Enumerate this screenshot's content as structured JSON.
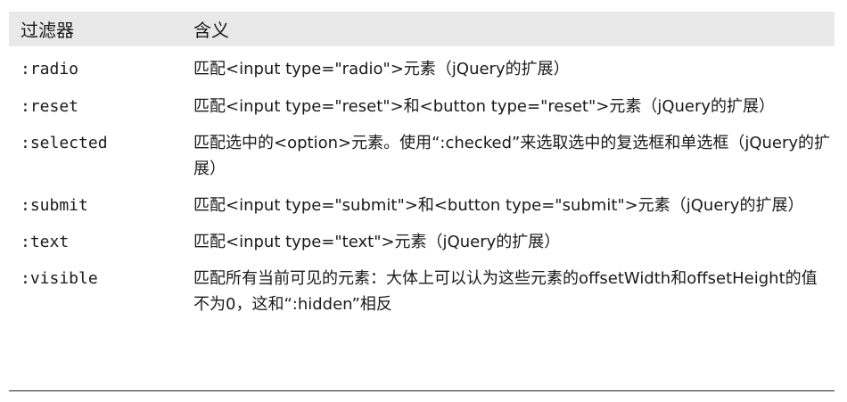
{
  "header": {
    "filter": "过滤器",
    "meaning": "含义"
  },
  "rows": [
    {
      "filter": ":radio",
      "meaning": "匹配<input type=\"radio\">元素（jQuery的扩展）"
    },
    {
      "filter": ":reset",
      "meaning": "匹配<input type=\"reset\">和<button type=\"reset\">元素（jQuery的扩展）"
    },
    {
      "filter": ":selected",
      "meaning": "匹配选中的<option>元素。使用“:checked”来选取选中的复选框和单选框（jQuery的扩展）"
    },
    {
      "filter": ":submit",
      "meaning": "匹配<input type=\"submit\">和<button type=\"submit\">元素（jQuery的扩展）"
    },
    {
      "filter": ":text",
      "meaning": "匹配<input type=\"text\">元素（jQuery的扩展）"
    },
    {
      "filter": ":visible",
      "meaning": "匹配所有当前可见的元素：大体上可以认为这些元素的offsetWidth和offsetHeight的值不为0，这和“:hidden”相反"
    }
  ]
}
